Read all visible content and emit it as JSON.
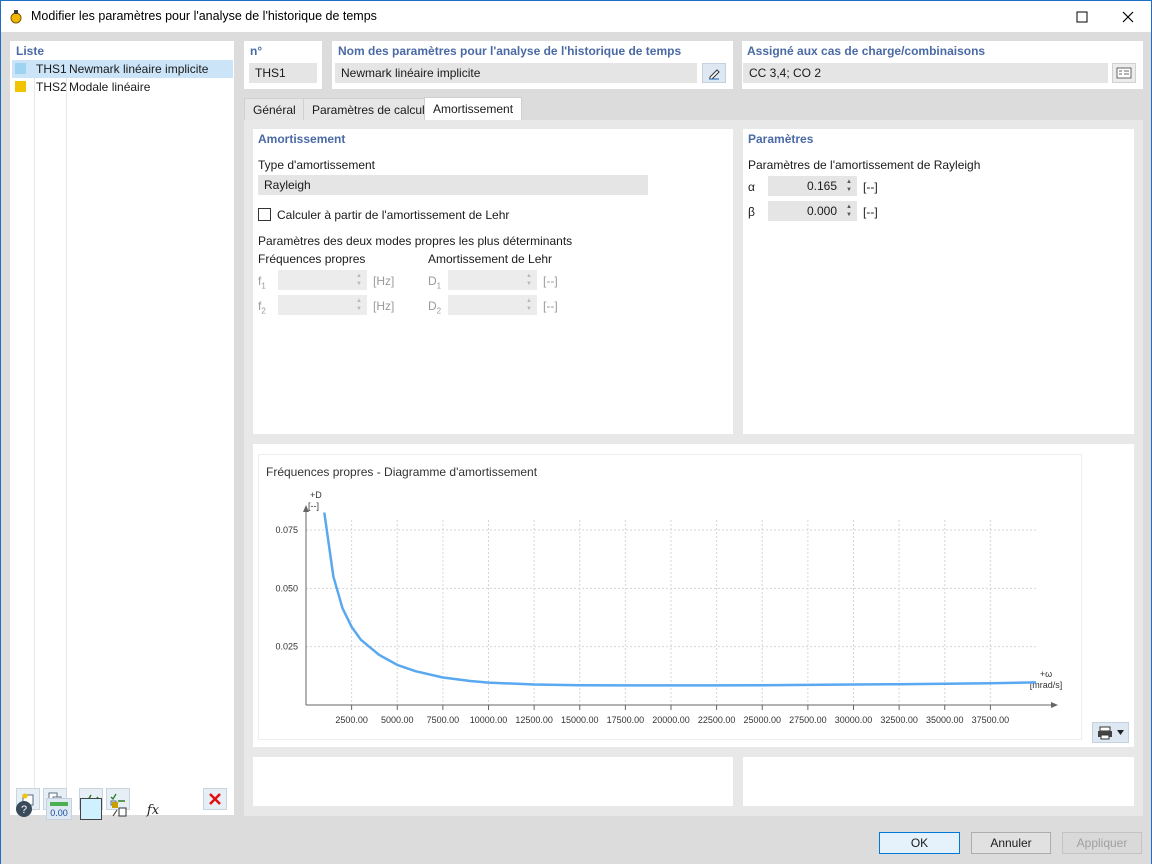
{
  "window": {
    "title": "Modifier les paramètres pour l'analyse de l'historique de temps"
  },
  "list": {
    "header": "Liste",
    "items": [
      {
        "code": "THS1",
        "name": "Newmark linéaire implicite",
        "color": "#9fd3f2",
        "selected": true
      },
      {
        "code": "THS2",
        "name": "Modale linéaire",
        "color": "#f2c300",
        "selected": false
      }
    ]
  },
  "header": {
    "no_label": "n°",
    "no_value": "THS1",
    "name_label": "Nom des paramètres pour l'analyse de l'historique de temps",
    "name_value": "Newmark linéaire implicite",
    "assigned_label": "Assigné aux cas de charge/combinaisons",
    "assigned_value": "CC 3,4; CO 2"
  },
  "tabs": [
    {
      "label": "Général",
      "active": false
    },
    {
      "label": "Paramètres de calcul",
      "active": false
    },
    {
      "label": "Amortissement",
      "active": true
    }
  ],
  "damping": {
    "section_title": "Amortissement",
    "type_label": "Type d'amortissement",
    "type_value": "Rayleigh",
    "lehr_checkbox_label": "Calculer à partir de l'amortissement de Lehr",
    "lehr_checked": false,
    "modes_label": "Paramètres des deux modes propres les plus déterminants",
    "freq_header": "Fréquences propres",
    "lehr_header": "Amortissement de Lehr",
    "f1_label": "f1",
    "f2_label": "f2",
    "d1_label": "D1",
    "d2_label": "D2",
    "hz_unit": "[Hz]",
    "dimensionless_unit": "[--]"
  },
  "params": {
    "section_title": "Paramètres",
    "rayleigh_label": "Paramètres de l'amortissement de Rayleigh",
    "alpha_symbol": "α",
    "alpha_value": "0.165",
    "beta_symbol": "β",
    "beta_value": "0.000",
    "unit": "[--]"
  },
  "chart_data": {
    "type": "line",
    "title": "Fréquences propres - Diagramme d'amortissement",
    "ylabel_top": "+D",
    "ylabel_unit": "[--]",
    "xlabel_top": "+ω",
    "xlabel_unit": "[mrad/s]",
    "xlim": [
      0,
      40000
    ],
    "ylim": [
      0,
      0.09
    ],
    "x_ticks": [
      2500,
      5000,
      7500,
      10000,
      12500,
      15000,
      17500,
      20000,
      22500,
      25000,
      27500,
      30000,
      32500,
      35000,
      37500
    ],
    "x_tick_labels": [
      "2500.00",
      "5000.00",
      "7500.00",
      "10000.00",
      "12500.00",
      "15000.00",
      "17500.00",
      "20000.00",
      "22500.00",
      "25000.00",
      "27500.00",
      "30000.00",
      "32500.00",
      "35000.00",
      "37500.00"
    ],
    "y_ticks": [
      0.025,
      0.05,
      0.075
    ],
    "y_tick_labels": [
      "0.025",
      "0.050",
      "0.075"
    ],
    "grid": true,
    "series": [
      {
        "color": "#5aa8f0",
        "x": [
          1000,
          1500,
          2000,
          2500,
          3000,
          4000,
          5000,
          6000,
          7500,
          9000,
          10000,
          12500,
          15000,
          17500,
          20000,
          22500,
          25000,
          27500,
          30000,
          32500,
          35000,
          37500,
          40000
        ],
        "y": [
          0.0825,
          0.055,
          0.0415,
          0.0335,
          0.028,
          0.0215,
          0.0172,
          0.0145,
          0.0118,
          0.0103,
          0.0096,
          0.0088,
          0.0085,
          0.0084,
          0.0084,
          0.0084,
          0.0085,
          0.0086,
          0.0088,
          0.0089,
          0.0091,
          0.0093,
          0.0097
        ]
      }
    ]
  },
  "footer": {
    "ok": "OK",
    "cancel": "Annuler",
    "apply": "Appliquer"
  }
}
